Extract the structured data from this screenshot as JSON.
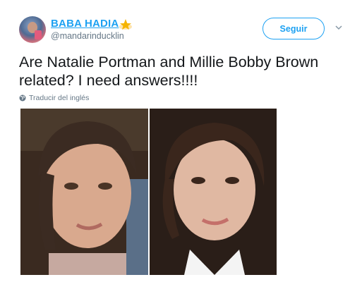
{
  "author": {
    "display_name": "BABA HADIA",
    "handle": "@mandarinducklin",
    "name_emoji": "star-emoji"
  },
  "actions": {
    "follow_label": "Seguir",
    "more_icon": "chevron-down-icon"
  },
  "tweet": {
    "text": "Are Natalie Portman and Millie Bobby Brown related? I need answers!!!!",
    "translate_label": "Traducir del inglés",
    "translate_icon": "globe-icon"
  },
  "colors": {
    "link_blue": "#1da1f2",
    "text_dark": "#14171a",
    "text_gray": "#657786"
  }
}
